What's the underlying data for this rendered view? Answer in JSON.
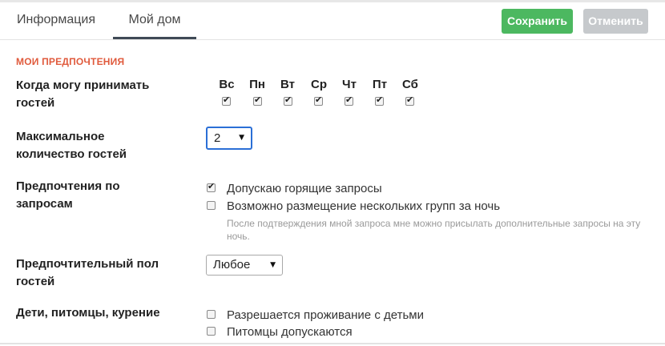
{
  "tabs": [
    {
      "label": "Информация"
    },
    {
      "label": "Мой дом"
    }
  ],
  "actions": {
    "save_label": "Сохранить",
    "cancel_label": "Отменить"
  },
  "section_title": "МОИ ПРЕДПОЧТЕНИЯ",
  "guest_days": {
    "label": "Когда могу принимать гостей",
    "label_lines": [
      "Когда могу принимать",
      "гостей"
    ],
    "days": [
      {
        "label": "Вс",
        "checked": true
      },
      {
        "label": "Пн",
        "checked": true
      },
      {
        "label": "Вт",
        "checked": true
      },
      {
        "label": "Ср",
        "checked": true
      },
      {
        "label": "Чт",
        "checked": true
      },
      {
        "label": "Пт",
        "checked": true
      },
      {
        "label": "Сб",
        "checked": true
      }
    ]
  },
  "max_guests": {
    "label_lines": [
      "Максимальное",
      "количество гостей"
    ],
    "value": "2"
  },
  "request_prefs": {
    "label_lines": [
      "Предпочтения по",
      "запросам"
    ],
    "options": [
      {
        "label": "Допускаю горящие запросы",
        "checked": true
      },
      {
        "label": "Возможно размещение нескольких групп за ночь",
        "checked": false
      }
    ],
    "hint": "После подтверждения мной запроса мне можно присылать дополнительные запросы на эту ночь."
  },
  "gender_pref": {
    "label_lines": [
      "Предпочтительный пол",
      "гостей"
    ],
    "value": "Любое"
  },
  "kids_pets": {
    "label": "Дети, питомцы, курение",
    "options": [
      {
        "label": "Разрешается проживание с детьми",
        "checked": false
      },
      {
        "label": "Питомцы допускаются",
        "checked": false
      }
    ]
  }
}
